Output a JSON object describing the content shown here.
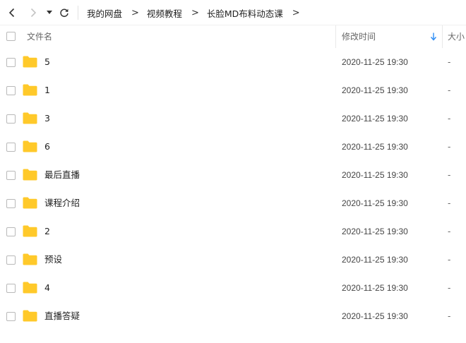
{
  "breadcrumb": {
    "items": [
      "我的网盘",
      "视频教程",
      "长脸MD布料动态课"
    ],
    "separator": ">"
  },
  "columns": {
    "name": "文件名",
    "modified": "修改时间",
    "size": "大小"
  },
  "icons": {
    "back": "chevron-left-icon",
    "forward": "chevron-right-icon",
    "history": "dropdown-triangle-icon",
    "refresh": "refresh-icon",
    "folder": "folder-icon",
    "sort": "sort-down-arrow-icon"
  },
  "colors": {
    "folder": "#ffc92a",
    "sort_arrow": "#2e8df5"
  },
  "files": [
    {
      "name": "5",
      "modified": "2020-11-25 19:30",
      "size": "-"
    },
    {
      "name": "1",
      "modified": "2020-11-25 19:30",
      "size": "-"
    },
    {
      "name": "3",
      "modified": "2020-11-25 19:30",
      "size": "-"
    },
    {
      "name": "6",
      "modified": "2020-11-25 19:30",
      "size": "-"
    },
    {
      "name": "最后直播",
      "modified": "2020-11-25 19:30",
      "size": "-"
    },
    {
      "name": "课程介绍",
      "modified": "2020-11-25 19:30",
      "size": "-"
    },
    {
      "name": "2",
      "modified": "2020-11-25 19:30",
      "size": "-"
    },
    {
      "name": "预设",
      "modified": "2020-11-25 19:30",
      "size": "-"
    },
    {
      "name": "4",
      "modified": "2020-11-25 19:30",
      "size": "-"
    },
    {
      "name": "直播答疑",
      "modified": "2020-11-25 19:30",
      "size": "-"
    }
  ]
}
